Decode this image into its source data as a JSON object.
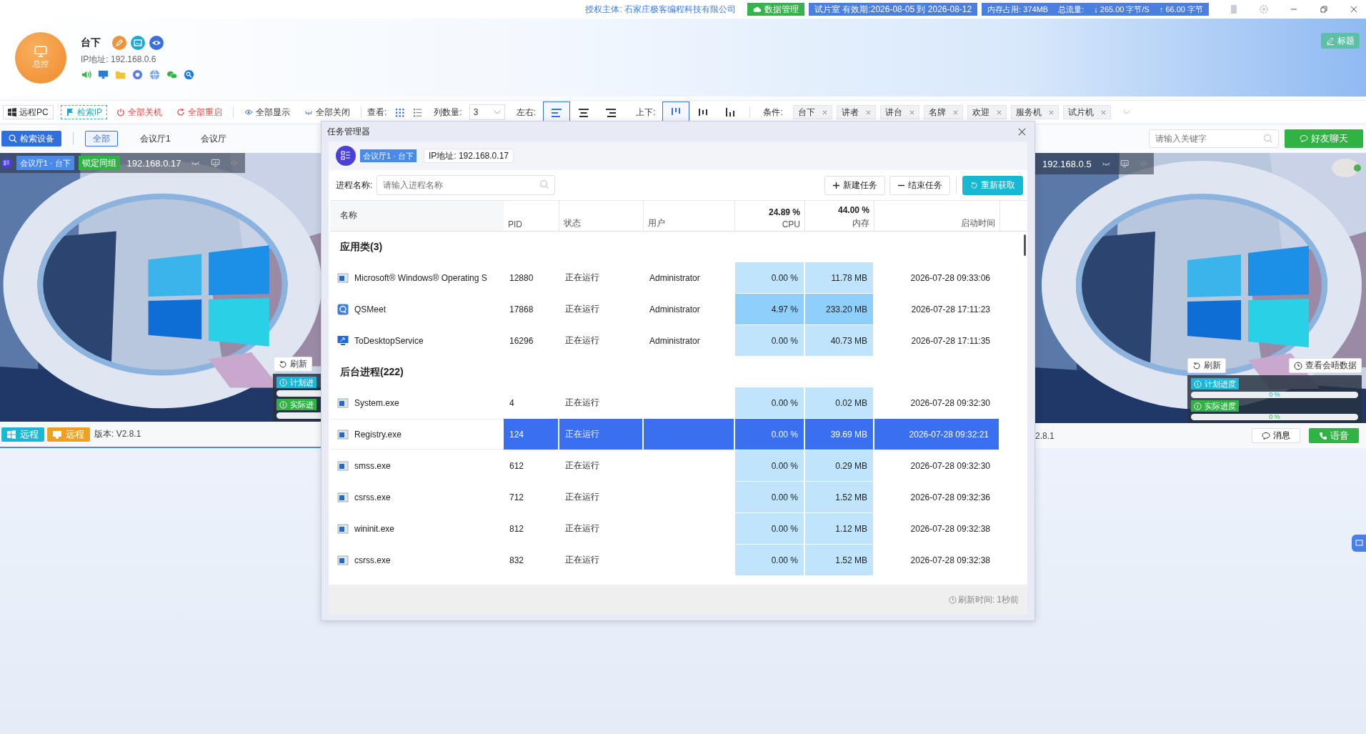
{
  "top_bar": {
    "license_label": "授权主体:",
    "license_holder": "石家庄极客编程科技有限公司",
    "data_button": "数据管理",
    "trial": "试片室 有效期:2026-08-05 到 2026-08-12",
    "memory": "内存占用: 374MB",
    "traffic_label": "总流量:",
    "download": "↓ 265.00 字节/S",
    "upload": "↑ 66.00 字节"
  },
  "profile": {
    "avatar_label": "总控",
    "name": "台下",
    "ip": "IP地址: 192.168.0.6"
  },
  "title_button": "标题",
  "toolbar": {
    "remote_pc": "远程PC",
    "search_ip": "检索IP",
    "shutdown_all": "全部关机",
    "restart_all": "全部重启",
    "show_all": "全部显示",
    "close_all": "全部关闭",
    "view_label": "查看:",
    "view_modes": [
      {
        "kind": "grid",
        "selected": true
      },
      {
        "kind": "list",
        "selected": false
      }
    ],
    "columns_label": "列数量:",
    "columns_value": "3",
    "horizontal_label": "左右:",
    "horizontal_align": [
      {
        "kind": "left",
        "selected": true
      },
      {
        "kind": "center",
        "selected": false
      },
      {
        "kind": "right",
        "selected": false
      }
    ],
    "vertical_label": "上下:",
    "vertical_align": [
      {
        "kind": "top",
        "selected": true
      },
      {
        "kind": "middle",
        "selected": false
      },
      {
        "kind": "bottom",
        "selected": false
      }
    ],
    "conditions_label": "条件:",
    "conditions": [
      "台下",
      "讲者",
      "讲台",
      "名牌",
      "欢迎",
      "服务机",
      "试片机"
    ]
  },
  "filter": {
    "search_button": "检索设备",
    "groups": [
      {
        "label": "全部",
        "selected": true
      },
      {
        "label": "会议厅1",
        "selected": false
      },
      {
        "label": "会议厅",
        "selected": false
      }
    ],
    "keyword_placeholder": "请输入关键字",
    "chat_button": "好友聊天"
  },
  "device_cards": [
    {
      "group_badge": "会议厅1 · 台下",
      "lock_badge": "锁定同组",
      "ip": "192.168.0.17",
      "refresh": "刷新",
      "plan": {
        "label": "计划进",
        "level": 0
      },
      "actual": {
        "label": "实际进",
        "level": 0
      },
      "remote_buttons": [
        {
          "kind": "windows",
          "label": "远程"
        },
        {
          "kind": "screen",
          "label": "远程"
        }
      ],
      "version": "版本: V2.8.1"
    },
    {
      "ip": "192.168.0.5",
      "online": true,
      "refresh": "刷新",
      "meeting_data": "查看会晤数据",
      "plan": {
        "label": "计划进度",
        "level": 0,
        "reading": "0 %"
      },
      "actual": {
        "label": "实际进度",
        "level": 0,
        "reading": "0 %"
      },
      "version": "2.8.1",
      "message": "消息",
      "voice": "语音"
    }
  ],
  "task_manager": {
    "title": "任务管理器",
    "device_badge": "会议厅1 · 台下",
    "ip": "IP地址: 192.168.0.17",
    "search_label": "进程名称:",
    "search_placeholder": "请输入进程名称",
    "buttons": [
      {
        "kind": "add",
        "label": "新建任务"
      },
      {
        "kind": "end",
        "label": "结束任务"
      },
      {
        "kind": "refresh",
        "label": "重新获取"
      }
    ],
    "columns": [
      {
        "label": "名称"
      },
      {
        "label": "PID"
      },
      {
        "label": "状态"
      },
      {
        "label": "用户"
      },
      {
        "total": "24.89 %",
        "label": "CPU"
      },
      {
        "total": "44.00 %",
        "label": "内存"
      },
      {
        "label": "启动时间"
      }
    ],
    "groups": [
      {
        "title": "应用类(3)",
        "rows": [
          {
            "kind": "window",
            "name": "Microsoft® Windows® Operating S",
            "pid": "12880",
            "status": "正在运行",
            "user": "Administrator",
            "cpu": "0.00 %",
            "memory": "11.78 MB",
            "started": "2026-07-28 09:33:06",
            "selected": false,
            "busy": false
          },
          {
            "kind": "q-app",
            "name": "QSMeet",
            "pid": "17868",
            "status": "正在运行",
            "user": "Administrator",
            "cpu": "4.97 %",
            "memory": "233.20 MB",
            "started": "2026-07-28 17:11:23",
            "selected": false,
            "busy": true
          },
          {
            "kind": "monitor",
            "name": "ToDesktopService",
            "pid": "16296",
            "status": "正在运行",
            "user": "Administrator",
            "cpu": "0.00 %",
            "memory": "40.73 MB",
            "started": "2026-07-28 17:11:35",
            "selected": false,
            "busy": false
          }
        ]
      },
      {
        "title": "后台进程(222)",
        "rows": [
          {
            "kind": "window",
            "name": "System.exe",
            "pid": "4",
            "status": "正在运行",
            "cpu": "0.00 %",
            "memory": "0.02 MB",
            "started": "2026-07-28 09:32:30",
            "selected": false,
            "busy": false
          },
          {
            "kind": "window",
            "name": "Registry.exe",
            "pid": "124",
            "status": "正在运行",
            "cpu": "0.00 %",
            "memory": "39.69 MB",
            "started": "2026-07-28 09:32:21",
            "selected": true,
            "busy": false
          },
          {
            "kind": "window",
            "name": "smss.exe",
            "pid": "612",
            "status": "正在运行",
            "cpu": "0.00 %",
            "memory": "0.29 MB",
            "started": "2026-07-28 09:32:30",
            "selected": false,
            "busy": false
          },
          {
            "kind": "window",
            "name": "csrss.exe",
            "pid": "712",
            "status": "正在运行",
            "cpu": "0.00 %",
            "memory": "1.52 MB",
            "started": "2026-07-28 09:32:36",
            "selected": false,
            "busy": false
          },
          {
            "kind": "window",
            "name": "wininit.exe",
            "pid": "812",
            "status": "正在运行",
            "cpu": "0.00 %",
            "memory": "1.12 MB",
            "started": "2026-07-28 09:32:38",
            "selected": false,
            "busy": false
          },
          {
            "kind": "window",
            "name": "csrss.exe",
            "pid": "832",
            "status": "正在运行",
            "cpu": "0.00 %",
            "memory": "1.52 MB",
            "started": "2026-07-28 09:32:38",
            "selected": false,
            "busy": false
          }
        ]
      }
    ],
    "refresh_time": "刷新时间: 1秒前"
  }
}
